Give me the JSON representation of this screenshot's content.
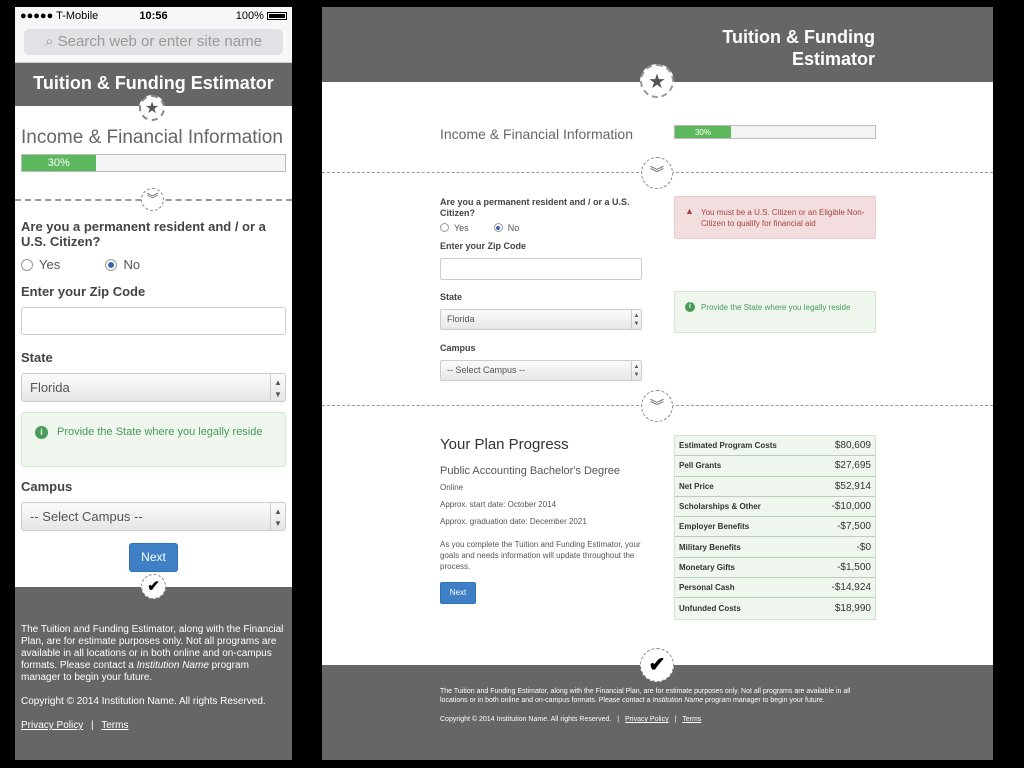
{
  "mobile": {
    "status": {
      "carrier": "●●●●● T-Mobile",
      "time": "10:56",
      "battery": "100%"
    },
    "url_placeholder": "Search web or enter site name",
    "header_title": "Tuition & Funding Estimator",
    "section_title": "Income & Financial Information",
    "progress_label": "30%",
    "progress_value": 0.3,
    "question": "Are you a permanent resident and / or a U.S. Citizen?",
    "yes_label": "Yes",
    "no_label": "No",
    "zip_label": "Enter your Zip Code",
    "state_label": "State",
    "state_value": "Florida",
    "state_info": "Provide the State where you legally reside",
    "campus_label": "Campus",
    "campus_value": "-- Select Campus --",
    "next_label": "Next",
    "footer_text_1": "The Tuition and Funding Estimator, along with the Financial Plan, are for estimate purposes only. Not all programs are available in all locations or in both online and on-campus formats. Please contact a",
    "footer_institution": "Institution Name",
    "footer_text_2": "program manager to begin your future.",
    "copyright": "Copyright © 2014 Institution Name. All rights Reserved.",
    "privacy": "Privacy Policy",
    "separator": "|",
    "terms": "Terms"
  },
  "desktop": {
    "header_line1": "Tuition & Funding",
    "header_line2": "Estimator",
    "section_title": "Income & Financial Information",
    "progress_label": "30%",
    "progress_value": 0.3,
    "question": "Are you a permanent resident and / or a U.S. Citizen?",
    "yes_label": "Yes",
    "no_label": "No",
    "zip_label": "Enter your Zip Code",
    "state_label": "State",
    "state_value": "Florida",
    "campus_label": "Campus",
    "campus_value": "-- Select Campus --",
    "alert": "You must be a U.S. Citizen or an Eligible Non-Citizen to qualify for financial aid",
    "state_info": "Provide the State where you legally reside",
    "plan_title": "Your Plan Progress",
    "degree": "Public Accounting Bachelor's Degree",
    "mode": "Online",
    "start_date": "Approx. start date: October 2014",
    "grad_date": "Approx. graduation date: December 2021",
    "plan_text": "As you complete the Tuition and Funding Estimator, your goals and needs information will update throughout the process.",
    "next_label": "Next",
    "cost_rows": [
      {
        "label": "Estimated Program Costs",
        "value": "$80,609"
      },
      {
        "label": "Pell Grants",
        "value": "$27,695"
      },
      {
        "label": "Net Price",
        "value": "$52,914"
      },
      {
        "label": "Scholarships & Other",
        "value": "-$10,000"
      },
      {
        "label": "Employer Benefits",
        "value": "-$7,500"
      },
      {
        "label": "Military Benefits",
        "value": "-$0"
      },
      {
        "label": "Monetary Gifts",
        "value": "-$1,500"
      },
      {
        "label": "Personal Cash",
        "value": "-$14,924"
      },
      {
        "label": "Unfunded Costs",
        "value": "$18,990"
      }
    ],
    "footer_text_1": "The Tuition and Funding Estimator, along with the Financial Plan, are for estimate purposes only. Not all programs are available in all locations or in both online and on-campus formats. Please contact a",
    "footer_institution": "Institution Name",
    "footer_text_2": "program manager to begin your future.",
    "copyright": "Copyright © 2014 Institution Name. All rights Reserved.",
    "separator": "|",
    "privacy": "Privacy Policy",
    "terms": "Terms"
  },
  "icons": {
    "star": "★",
    "chevron": "»",
    "check": "✔",
    "info": "i",
    "warning": "▲",
    "search": "⌕",
    "select_arrows": "▲▼"
  },
  "colors": {
    "header": "#666666",
    "progress": "#5cb85c",
    "button": "#3f7fc6",
    "alert": "#a94442",
    "info": "#4a9a5a"
  }
}
